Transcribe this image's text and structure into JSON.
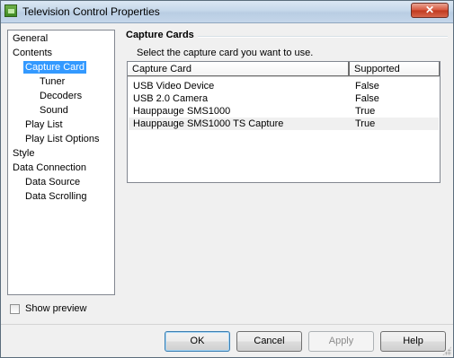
{
  "window": {
    "title": "Television Control Properties",
    "close_label": "✕"
  },
  "tree": {
    "items": [
      {
        "label": "General"
      },
      {
        "label": "Contents"
      },
      {
        "label": "Capture Card"
      },
      {
        "label": "Tuner"
      },
      {
        "label": "Decoders"
      },
      {
        "label": "Sound"
      },
      {
        "label": "Play List"
      },
      {
        "label": "Play List Options"
      },
      {
        "label": "Style"
      },
      {
        "label": "Data Connection"
      },
      {
        "label": "Data Source"
      },
      {
        "label": "Data Scrolling"
      }
    ],
    "selected": "Capture Card"
  },
  "show_preview": {
    "label": "Show preview",
    "checked": false
  },
  "group": {
    "title": "Capture Cards",
    "instruction": "Select the capture card you want to use."
  },
  "list": {
    "columns": [
      "Capture Card",
      "Supported"
    ],
    "rows": [
      {
        "card": "USB Video Device",
        "supported": "False"
      },
      {
        "card": "USB 2.0 Camera",
        "supported": "False"
      },
      {
        "card": "Hauppauge SMS1000",
        "supported": "True"
      },
      {
        "card": "Hauppauge SMS1000 TS Capture",
        "supported": "True"
      }
    ]
  },
  "buttons": {
    "ok": "OK",
    "cancel": "Cancel",
    "apply": "Apply",
    "help": "Help"
  }
}
